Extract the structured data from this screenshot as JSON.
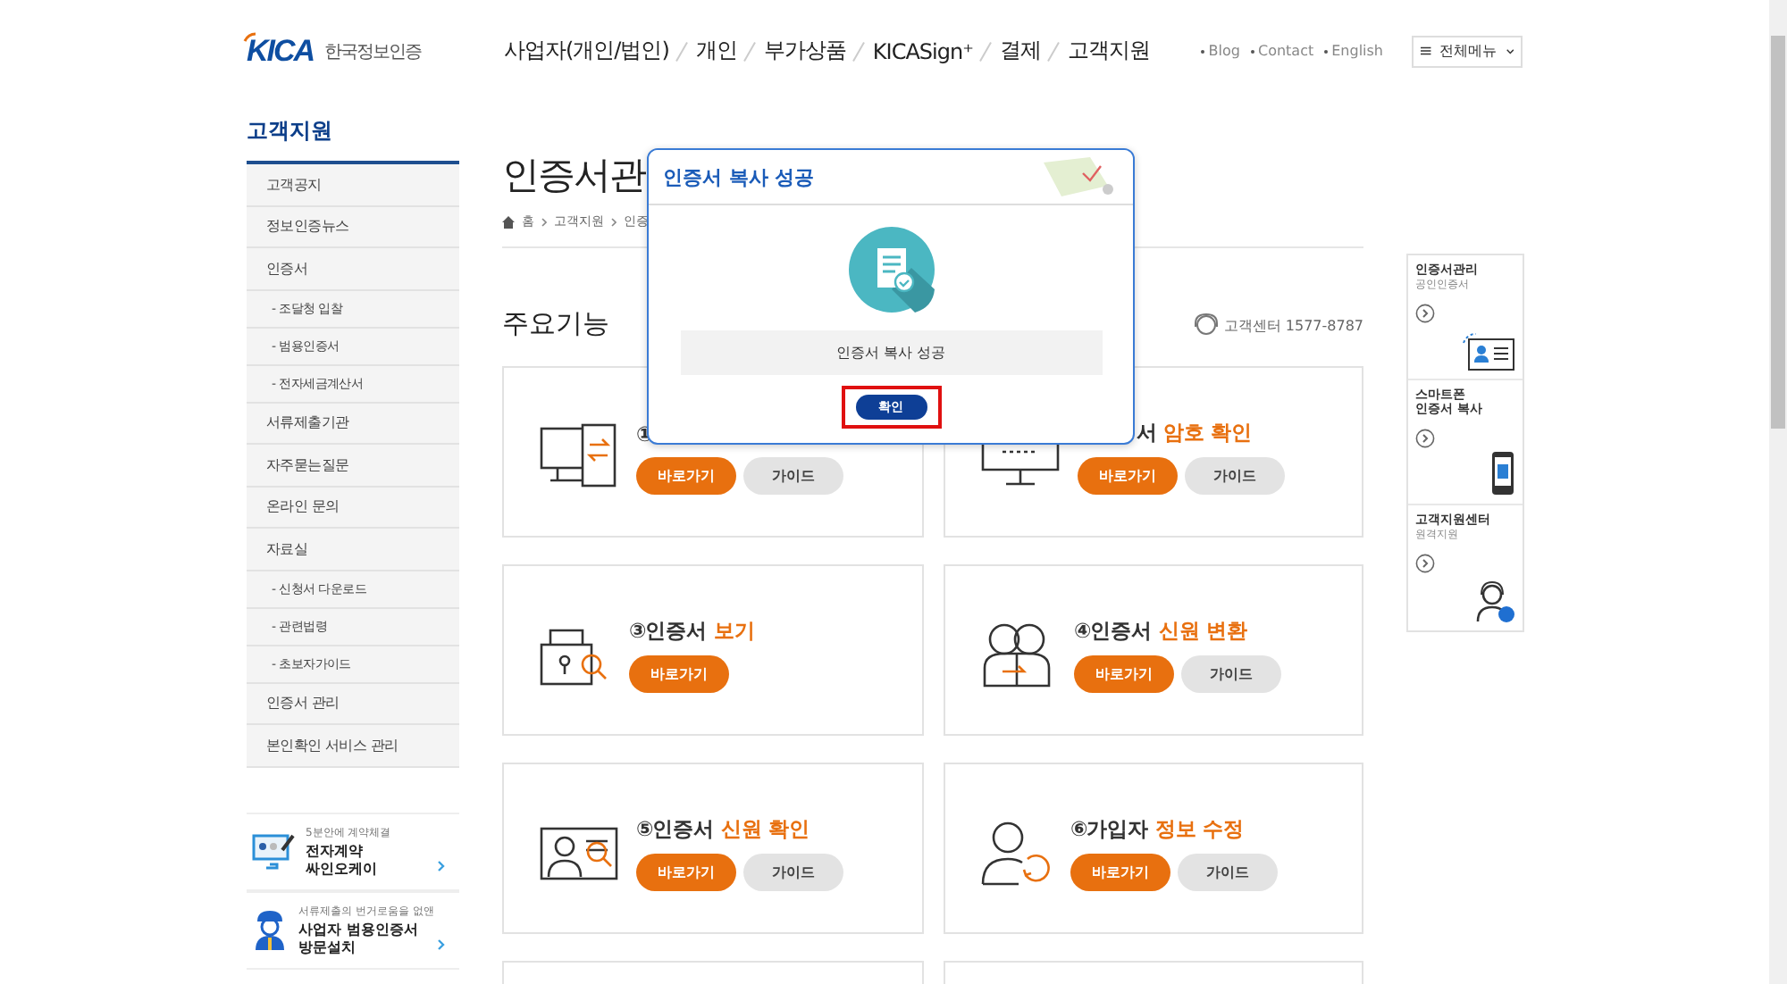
{
  "header": {
    "logo": {
      "mark": "KICA",
      "name": "한국정보인증"
    },
    "nav": [
      "사업자(개인/법인)",
      "개인",
      "부가상품",
      "KICASign⁺",
      "결제",
      "고객지원"
    ],
    "util_links": [
      "Blog",
      "Contact",
      "English"
    ],
    "all_menu": "전체메뉴"
  },
  "sidebar": {
    "title": "고객지원",
    "items": [
      {
        "label": "고객공지",
        "kind": "main"
      },
      {
        "label": "정보인증뉴스",
        "kind": "main"
      },
      {
        "label": "인증서",
        "kind": "main"
      },
      {
        "label": "- 조달청 입찰",
        "kind": "sub"
      },
      {
        "label": "- 범용인증서",
        "kind": "sub"
      },
      {
        "label": "- 전자세금계산서",
        "kind": "sub"
      },
      {
        "label": "서류제출기관",
        "kind": "main"
      },
      {
        "label": "자주묻는질문",
        "kind": "main"
      },
      {
        "label": "온라인 문의",
        "kind": "main"
      },
      {
        "label": "자료실",
        "kind": "main"
      },
      {
        "label": "- 신청서 다운로드",
        "kind": "sub"
      },
      {
        "label": "- 관련법령",
        "kind": "sub"
      },
      {
        "label": "- 초보자가이드",
        "kind": "sub"
      },
      {
        "label": "인증서 관리",
        "kind": "main"
      },
      {
        "label": "본인확인 서비스 관리",
        "kind": "main"
      }
    ],
    "banners": [
      {
        "caption": "5분안에 계약체결",
        "title": "전자계약\n싸인오케이",
        "kind": "contract"
      },
      {
        "caption": "서류제출의 번거로움을 없앤",
        "title": "사업자 범용인증서\n방문설치",
        "kind": "visit"
      }
    ]
  },
  "main": {
    "title": "인증서관",
    "breadcrumb": [
      "홈",
      "고객지원",
      "인증"
    ],
    "section_title": "주요기능",
    "support": "고객센터 1577-8787",
    "cards": [
      {
        "kind": "monitor-transfer",
        "prefix": "①",
        "covered": false,
        "go": "바로가기",
        "guide": "가이드"
      },
      {
        "kind": "monitor-password",
        "prefix": "서",
        "highlight": "암호 확인",
        "covered": true,
        "go": "바로가기",
        "guide": "가이드"
      },
      {
        "kind": "lock-search",
        "prefix": "③인증서",
        "highlight": "보기",
        "covered": false,
        "go": "바로가기"
      },
      {
        "kind": "people-arrow",
        "prefix": "④인증서",
        "highlight": "신원 변환",
        "covered": false,
        "go": "바로가기",
        "guide": "가이드"
      },
      {
        "kind": "id-search",
        "prefix": "⑤인증서",
        "highlight": "신원 확인",
        "covered": false,
        "go": "바로가기",
        "guide": "가이드"
      },
      {
        "kind": "user-refresh",
        "prefix": "⑥가입자",
        "highlight": "정보 수정",
        "covered": false,
        "go": "바로가기",
        "guide": "가이드"
      },
      {
        "kind": "empty"
      },
      {
        "kind": "empty"
      }
    ]
  },
  "quick": [
    {
      "title": "인증서관리",
      "subtitle": "공인인증서",
      "kind": "id-card"
    },
    {
      "title": "스마트폰\n인증서 복사",
      "kind": "phone"
    },
    {
      "title": "고객지원센터",
      "subtitle": "원격지원",
      "kind": "agent"
    }
  ],
  "dialog": {
    "title": "인증서 복사 성공",
    "message": "인증서 복사 성공",
    "button": "확인"
  }
}
